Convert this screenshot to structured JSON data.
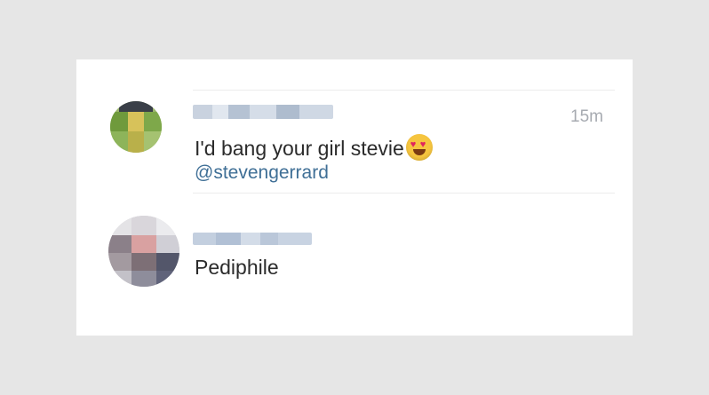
{
  "comments": [
    {
      "timestamp": "15m",
      "text": "I'd bang your girl stevie",
      "emoji": "heart-eyes-emoji",
      "mention": "@stevengerrard"
    },
    {
      "text": "Pediphile"
    }
  ],
  "colors": {
    "background": "#e6e6e6",
    "card": "#ffffff",
    "text": "#2b2b2b",
    "mention": "#3f6f96",
    "timestamp": "#a7abb1"
  }
}
